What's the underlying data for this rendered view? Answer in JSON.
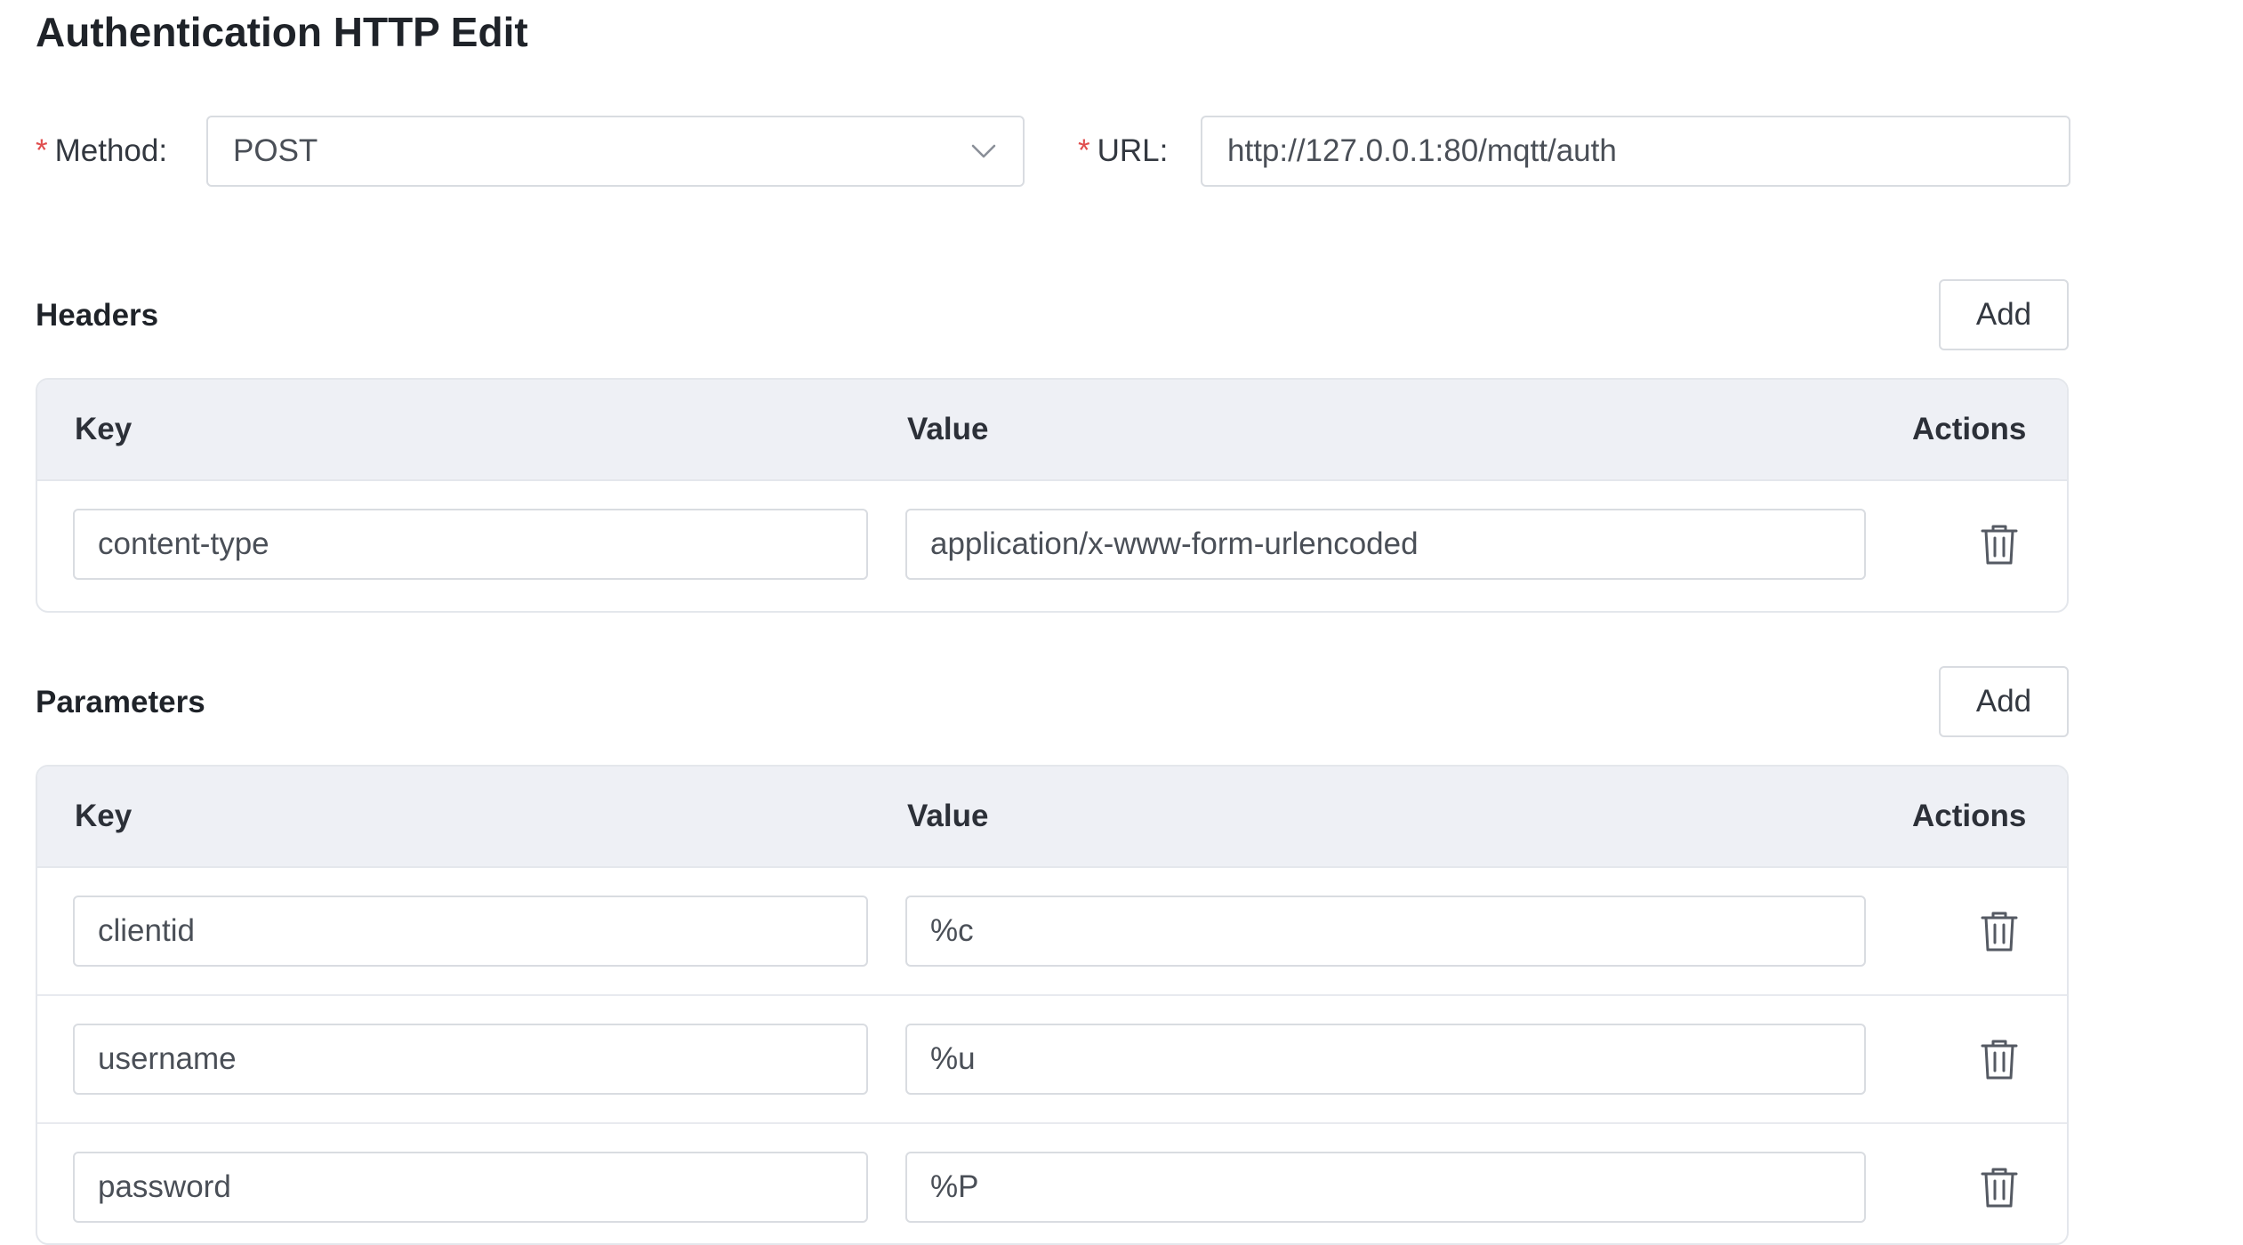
{
  "page": {
    "title": "Authentication HTTP Edit"
  },
  "form": {
    "required_mark": "*",
    "method": {
      "label": "Method:",
      "value": "POST"
    },
    "url": {
      "label": "URL:",
      "value": "http://127.0.0.1:80/mqtt/auth"
    }
  },
  "headers": {
    "title": "Headers",
    "add_label": "Add",
    "columns": {
      "key": "Key",
      "value": "Value",
      "actions": "Actions"
    },
    "rows": [
      {
        "key": "content-type",
        "value": "application/x-www-form-urlencoded",
        "action_icon": "trash-icon"
      }
    ]
  },
  "parameters": {
    "title": "Parameters",
    "add_label": "Add",
    "columns": {
      "key": "Key",
      "value": "Value",
      "actions": "Actions"
    },
    "rows": [
      {
        "key": "clientid",
        "value": "%c",
        "action_icon": "trash-icon"
      },
      {
        "key": "username",
        "value": "%u",
        "action_icon": "trash-icon"
      },
      {
        "key": "password",
        "value": "%P",
        "action_icon": "trash-icon"
      }
    ]
  },
  "colors": {
    "required": "#e04e4e",
    "table_header_bg": "#eef0f5",
    "border": "#d9dce1",
    "text": "#1f2329"
  },
  "icons": {
    "select_arrow": "chevron-down-icon",
    "row_delete": "trash-icon"
  }
}
